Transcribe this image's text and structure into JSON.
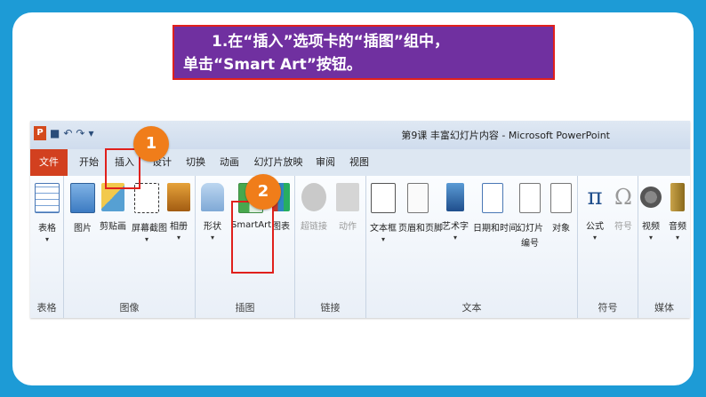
{
  "instruction": {
    "line1": "1.在“插入”选项卡的“插图”组中，",
    "line2": "单击“Smart Art”按钮。"
  },
  "window": {
    "title": "第9课  丰富幻灯片内容 - Microsoft PowerPoint",
    "app_icon": "P"
  },
  "tabs": [
    "文件",
    "开始",
    "插入",
    "设计",
    "切换",
    "动画",
    "幻灯片放映",
    "审阅",
    "视图"
  ],
  "groups": {
    "tables": {
      "name": "表格",
      "buttons": [
        "表格"
      ]
    },
    "images": {
      "name": "图像",
      "buttons": [
        "图片",
        "剪贴画",
        "屏幕截图",
        "相册"
      ]
    },
    "illustrations": {
      "name": "插图",
      "buttons": [
        "形状",
        "SmartArt",
        "图表"
      ]
    },
    "links": {
      "name": "链接",
      "buttons": [
        "超链接",
        "动作"
      ]
    },
    "text": {
      "name": "文本",
      "buttons": [
        "文本框",
        "页眉和页脚",
        "艺术字",
        "日期和时间",
        "幻灯片",
        "对象"
      ],
      "sub": "编号"
    },
    "symbols": {
      "name": "符号",
      "buttons": [
        "公式",
        "符号"
      ]
    },
    "media": {
      "name": "媒体",
      "buttons": [
        "视频",
        "音频"
      ]
    }
  },
  "callouts": [
    "1",
    "2"
  ],
  "colors": {
    "banner": "#7030a0",
    "highlight": "#e0201c",
    "badge": "#f07d1a",
    "file_tab": "#d2401f",
    "background": "#1d9bd6"
  }
}
